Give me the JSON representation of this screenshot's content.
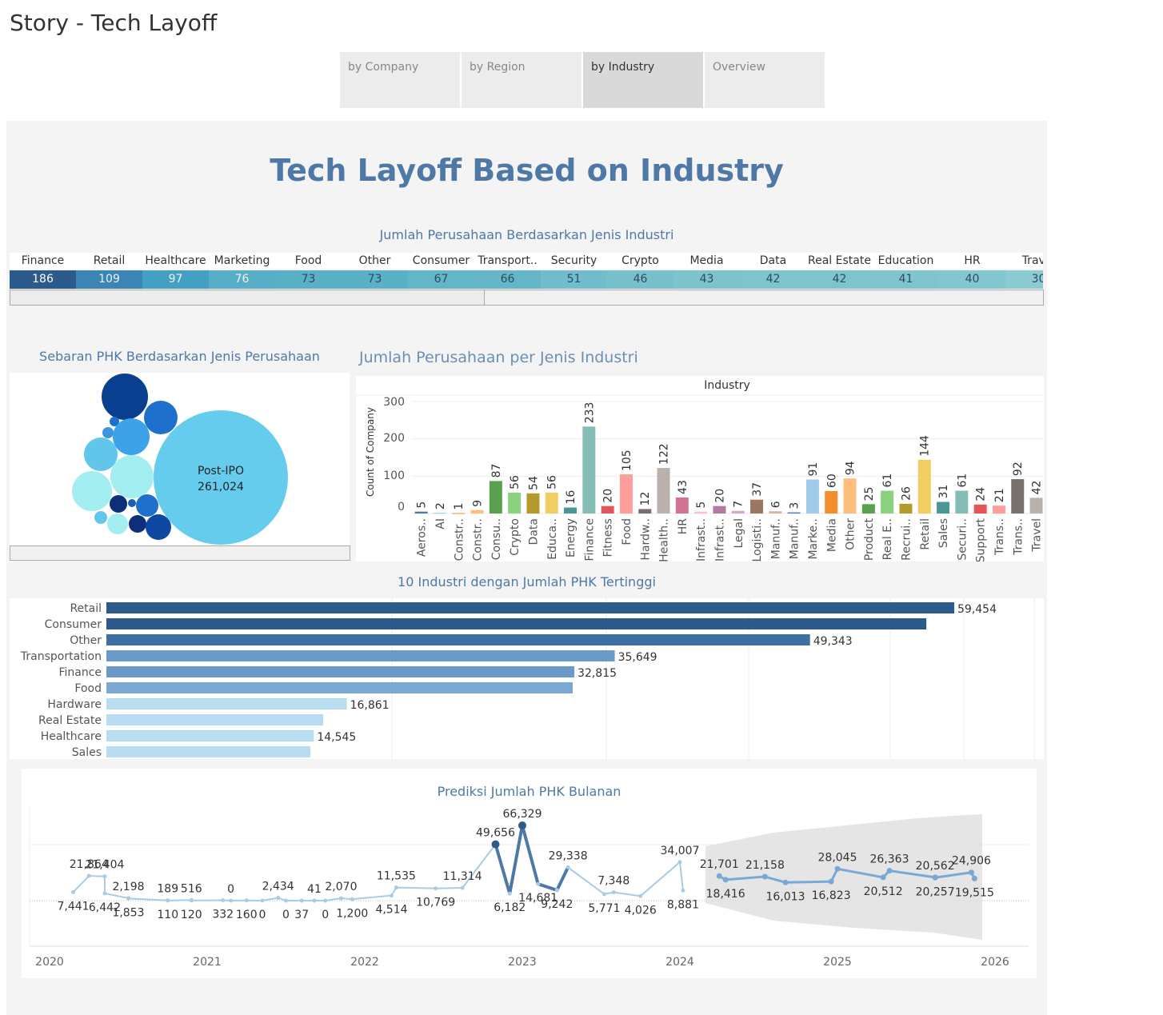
{
  "story": {
    "title": "Story - Tech Layoff"
  },
  "tabs": [
    {
      "label": "by Company",
      "active": false
    },
    {
      "label": "by Region",
      "active": false
    },
    {
      "label": "by Industry",
      "active": true
    },
    {
      "label": "Overview",
      "active": false
    }
  ],
  "dashboard": {
    "title": "Tech Layoff Based on Industry"
  },
  "industry_strip": {
    "title": "Jumlah Perusahaan Berdasarkan Jenis Industri",
    "items": [
      {
        "name": "Finance",
        "value": "186",
        "color": "#2c5a8a"
      },
      {
        "name": "Retail",
        "value": "109",
        "color": "#3a85b5"
      },
      {
        "name": "Healthcare",
        "value": "97",
        "color": "#44a0c2"
      },
      {
        "name": "Marketing",
        "value": "76",
        "color": "#57aec6"
      },
      {
        "name": "Food",
        "value": "73",
        "color": "#5ab0c6"
      },
      {
        "name": "Other",
        "value": "73",
        "color": "#5ab0c6"
      },
      {
        "name": "Consumer",
        "value": "67",
        "color": "#63b5c8"
      },
      {
        "name": "Transport..",
        "value": "66",
        "color": "#65b6c9"
      },
      {
        "name": "Security",
        "value": "51",
        "color": "#72bdcb"
      },
      {
        "name": "Crypto",
        "value": "46",
        "color": "#78c1cc"
      },
      {
        "name": "Media",
        "value": "43",
        "color": "#7cc3cd"
      },
      {
        "name": "Data",
        "value": "42",
        "color": "#7ec4ce"
      },
      {
        "name": "Real Estate",
        "value": "42",
        "color": "#7ec4ce"
      },
      {
        "name": "Education",
        "value": "41",
        "color": "#80c5ce"
      },
      {
        "name": "HR",
        "value": "40",
        "color": "#82c6cf"
      },
      {
        "name": "Travel",
        "value": "30",
        "color": "#8ccbd1"
      }
    ]
  },
  "bubble": {
    "title": "Sebaran PHK Berdasarkan Jenis Perusahaan",
    "label": "Post-IPO",
    "value": "261,024"
  },
  "count_chart": {
    "title": "Jumlah Perusahaan per Jenis Industri",
    "header": "Industry",
    "ylabel": "Count of Company",
    "yticks": [
      "300",
      "200",
      "100",
      "0"
    ]
  },
  "top10": {
    "title": "10 Industri dengan Jumlah PHK Tertinggi"
  },
  "forecast": {
    "title": "Prediksi Jumlah PHK Bulanan"
  },
  "chart_data": [
    {
      "type": "bar",
      "id": "count_per_industry",
      "title": "Jumlah Perusahaan per Jenis Industri",
      "xlabel": "Industry",
      "ylabel": "Count of Company",
      "ylim": [
        0,
        300
      ],
      "categories": [
        "Aeros..",
        "AI",
        "Constr..",
        "Constr..",
        "Consu..",
        "Crypto",
        "Data",
        "Educa..",
        "Energy",
        "Finance",
        "Fitness",
        "Food",
        "Hardw..",
        "Health..",
        "HR",
        "Infrast..",
        "Infrast..",
        "Legal",
        "Logisti..",
        "Manuf..",
        "Manuf..",
        "Marke..",
        "Media",
        "Other",
        "Product",
        "Real E..",
        "Recrui..",
        "Retail",
        "Sales",
        "Securi..",
        "Support",
        "Trans..",
        "Trans..",
        "Travel"
      ],
      "values": [
        5,
        2,
        1,
        9,
        87,
        56,
        54,
        56,
        16,
        233,
        20,
        105,
        12,
        122,
        43,
        5,
        20,
        7,
        37,
        6,
        3,
        91,
        60,
        94,
        25,
        61,
        26,
        144,
        31,
        61,
        24,
        21,
        92,
        42
      ],
      "colors": [
        "#4e79a7",
        "#a0cbe8",
        "#f28e2b",
        "#ffbe7d",
        "#59a14f",
        "#8cd17d",
        "#b6992d",
        "#f1ce63",
        "#499894",
        "#86bcb6",
        "#e15759",
        "#ff9d9a",
        "#79706e",
        "#bab0ac",
        "#d37295",
        "#fabfd2",
        "#b07aa1",
        "#d4a6c8",
        "#9d7660",
        "#d7b5a6",
        "#4e79a7",
        "#a0cbe8",
        "#f28e2b",
        "#ffbe7d",
        "#59a14f",
        "#8cd17d",
        "#b6992d",
        "#f1ce63",
        "#499894",
        "#86bcb6",
        "#e15759",
        "#ff9d9a",
        "#79706e",
        "#bab0ac"
      ]
    },
    {
      "type": "bar",
      "id": "top10_layoffs",
      "title": "10 Industri dengan Jumlah PHK Tertinggi",
      "categories": [
        "Retail",
        "Consumer",
        "Other",
        "Transportation",
        "Finance",
        "Food",
        "Hardware",
        "Real Estate",
        "Healthcare",
        "Sales"
      ],
      "values": [
        59454,
        57500,
        49343,
        35649,
        32815,
        32700,
        16861,
        15200,
        14545,
        14300
      ],
      "labels": [
        "59,454",
        "",
        "49,343",
        "35,649",
        "32,815",
        "",
        "16,861",
        "",
        "14,545",
        ""
      ],
      "colors": [
        "#2c5a8a",
        "#2c5a8a",
        "#3d6fa5",
        "#6a9bc8",
        "#6a9bc8",
        "#7aa8d0",
        "#b8dcf0",
        "#b8dcf0",
        "#b8dcf0",
        "#b8dcf0"
      ]
    },
    {
      "type": "line",
      "id": "monthly_forecast",
      "title": "Prediksi Jumlah PHK Bulanan",
      "xticks": [
        "2020",
        "2021",
        "2022",
        "2023",
        "2024",
        "2025",
        "2026"
      ],
      "actual_labels": [
        {
          "year": 2020.15,
          "value": 7441,
          "text": "7,441",
          "pos": "below"
        },
        {
          "year": 2020.25,
          "value": 21864,
          "text": "21,864",
          "pos": "above"
        },
        {
          "year": 2020.35,
          "value": 21404,
          "text": "21,404",
          "pos": "above"
        },
        {
          "year": 2020.35,
          "value": 6442,
          "text": "6,442",
          "pos": "below"
        },
        {
          "year": 2020.5,
          "value": 2198,
          "text": "2,198",
          "pos": "above"
        },
        {
          "year": 2020.5,
          "value": 1853,
          "text": "1,853",
          "pos": "below"
        },
        {
          "year": 2020.75,
          "value": 189,
          "text": "189",
          "pos": "above"
        },
        {
          "year": 2020.75,
          "value": 110,
          "text": "110",
          "pos": "below"
        },
        {
          "year": 2020.9,
          "value": 516,
          "text": "516",
          "pos": "above"
        },
        {
          "year": 2020.9,
          "value": 120,
          "text": "120",
          "pos": "below"
        },
        {
          "year": 2021.15,
          "value": 0,
          "text": "0",
          "pos": "above"
        },
        {
          "year": 2021.1,
          "value": 332,
          "text": "332",
          "pos": "below"
        },
        {
          "year": 2021.25,
          "value": 160,
          "text": "160",
          "pos": "below"
        },
        {
          "year": 2021.35,
          "value": 0,
          "text": "0",
          "pos": "below"
        },
        {
          "year": 2021.45,
          "value": 2434,
          "text": "2,434",
          "pos": "above"
        },
        {
          "year": 2021.5,
          "value": 0,
          "text": "0",
          "pos": "below"
        },
        {
          "year": 2021.6,
          "value": 37,
          "text": "37",
          "pos": "below"
        },
        {
          "year": 2021.68,
          "value": 41,
          "text": "41",
          "pos": "above"
        },
        {
          "year": 2021.75,
          "value": 0,
          "text": "0",
          "pos": "below"
        },
        {
          "year": 2021.85,
          "value": 2070,
          "text": "2,070",
          "pos": "above"
        },
        {
          "year": 2021.92,
          "value": 1200,
          "text": "1,200",
          "pos": "below"
        },
        {
          "year": 2022.2,
          "value": 11535,
          "text": "11,535",
          "pos": "above"
        },
        {
          "year": 2022.17,
          "value": 4514,
          "text": "4,514",
          "pos": "below"
        },
        {
          "year": 2022.45,
          "value": 10769,
          "text": "10,769",
          "pos": "below"
        },
        {
          "year": 2022.62,
          "value": 11314,
          "text": "11,314",
          "pos": "above"
        },
        {
          "year": 2022.83,
          "value": 49656,
          "text": "49,656",
          "pos": "above"
        },
        {
          "year": 2022.92,
          "value": 6182,
          "text": "6,182",
          "pos": "below"
        },
        {
          "year": 2023.0,
          "value": 66329,
          "text": "66,329",
          "pos": "above"
        },
        {
          "year": 2023.1,
          "value": 14681,
          "text": "14,681",
          "pos": "below"
        },
        {
          "year": 2023.29,
          "value": 29338,
          "text": "29,338",
          "pos": "above"
        },
        {
          "year": 2023.22,
          "value": 9242,
          "text": "9,242",
          "pos": "below"
        },
        {
          "year": 2023.58,
          "value": 7348,
          "text": "7,348",
          "pos": "above"
        },
        {
          "year": 2023.52,
          "value": 5771,
          "text": "5,771",
          "pos": "below"
        },
        {
          "year": 2023.75,
          "value": 4026,
          "text": "4,026",
          "pos": "below"
        },
        {
          "year": 2024.0,
          "value": 34007,
          "text": "34,007",
          "pos": "above"
        },
        {
          "year": 2024.02,
          "value": 8881,
          "text": "8,881",
          "pos": "below"
        }
      ],
      "forecast_labels": [
        {
          "year": 2024.25,
          "value": 21701,
          "text": "21,701",
          "pos": "above"
        },
        {
          "year": 2024.29,
          "value": 18416,
          "text": "18,416",
          "pos": "below"
        },
        {
          "year": 2024.54,
          "value": 21158,
          "text": "21,158",
          "pos": "above"
        },
        {
          "year": 2024.67,
          "value": 16013,
          "text": "16,013",
          "pos": "below"
        },
        {
          "year": 2024.96,
          "value": 16823,
          "text": "16,823",
          "pos": "below"
        },
        {
          "year": 2025.0,
          "value": 28045,
          "text": "28,045",
          "pos": "above"
        },
        {
          "year": 2025.29,
          "value": 20512,
          "text": "20,512",
          "pos": "below"
        },
        {
          "year": 2025.33,
          "value": 26363,
          "text": "26,363",
          "pos": "above"
        },
        {
          "year": 2025.62,
          "value": 20562,
          "text": "20,562",
          "pos": "above"
        },
        {
          "year": 2025.62,
          "value": 20257,
          "text": "20,257",
          "pos": "below"
        },
        {
          "year": 2025.85,
          "value": 24906,
          "text": "24,906",
          "pos": "above"
        },
        {
          "year": 2025.87,
          "value": 19515,
          "text": "19,515",
          "pos": "below"
        }
      ]
    }
  ]
}
